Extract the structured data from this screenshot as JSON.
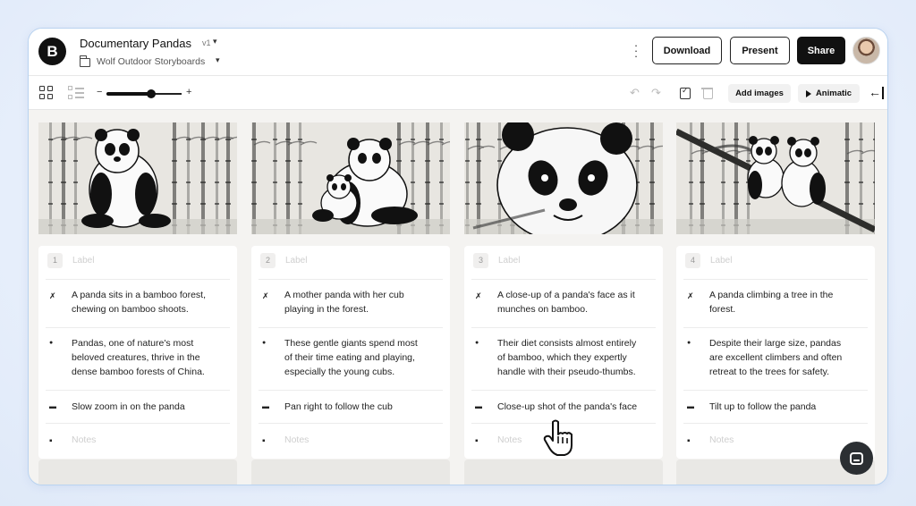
{
  "header": {
    "logo_letter": "B",
    "doc_title": "Documentary Pandas",
    "version": "v1",
    "folder": "Wolf Outdoor Storyboards",
    "more_icon": "kebab-icon",
    "buttons": {
      "download": "Download",
      "present": "Present",
      "share": "Share"
    }
  },
  "toolbar": {
    "zoom_minus": "−",
    "zoom_plus": "+",
    "zoom_level": 0.7,
    "add_images": "Add images",
    "animatic": "Animatic"
  },
  "frames": [
    {
      "number": "1",
      "label_placeholder": "Label",
      "action": [
        "A panda sits in a bamboo forest,",
        "chewing on bamboo shoots."
      ],
      "dialogue": [
        "Pandas, one of nature's most",
        "beloved creatures, thrive in the",
        "dense bamboo forests of China."
      ],
      "camera": "Slow zoom in on the panda",
      "notes_placeholder": "Notes"
    },
    {
      "number": "2",
      "label_placeholder": "Label",
      "action": [
        "A mother panda with her cub",
        "playing in the forest."
      ],
      "dialogue": [
        "These gentle giants spend most",
        "of their time eating and playing,",
        "especially the young cubs."
      ],
      "camera": "Pan right to follow the cub",
      "notes_placeholder": "Notes"
    },
    {
      "number": "3",
      "label_placeholder": "Label",
      "action": [
        "A close-up of a panda's face as it",
        "munches on bamboo."
      ],
      "dialogue": [
        "Their diet consists almost entirely",
        "of bamboo, which they expertly",
        "handle with their pseudo-thumbs."
      ],
      "camera": "Close-up shot of the panda's face",
      "notes_placeholder": "Notes"
    },
    {
      "number": "4",
      "label_placeholder": "Label",
      "action": [
        "A panda climbing a tree in the",
        "forest."
      ],
      "dialogue": [
        "Despite their large size, pandas",
        "are excellent climbers and often",
        "retreat to the trees for safety."
      ],
      "camera": "Tilt up to follow the panda",
      "notes_placeholder": "Notes"
    }
  ],
  "icons": {
    "action": "running-figure-icon",
    "dialogue": "microphone-icon",
    "camera": "video-camera-icon",
    "notes": "notepad-icon"
  },
  "colors": {
    "accent": "#111111",
    "window_border": "#b9d3f0",
    "chat_button": "#2b2f33"
  }
}
